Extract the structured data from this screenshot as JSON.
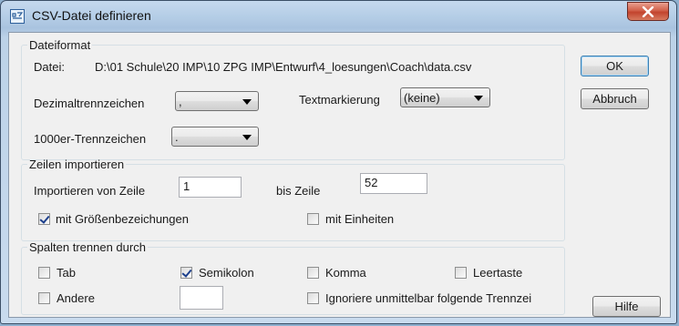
{
  "window": {
    "title": "CSV-Datei definieren"
  },
  "dateiformat": {
    "legend": "Dateiformat",
    "datei_label": "Datei:",
    "datei_path": "D:\\01 Schule\\20 IMP\\10 ZPG IMP\\Entwurf\\4_loesungen\\Coach\\data.csv",
    "dezimal_label": "Dezimaltrennzeichen",
    "dezimal_value": ",",
    "textmark_label": "Textmarkierung",
    "textmark_value": "(keine)",
    "tausend_label": "1000er-Trennzeichen",
    "tausend_value": "."
  },
  "zeilen": {
    "legend": "Zeilen importieren",
    "von_label": "Importieren von Zeile",
    "von_value": "1",
    "bis_label": "bis Zeile",
    "bis_value": "52",
    "groessen_label": "mit Größenbezeichungen",
    "groessen_checked": true,
    "einheiten_label": "mit Einheiten",
    "einheiten_checked": false
  },
  "spalten": {
    "legend": "Spalten trennen durch",
    "tab_label": "Tab",
    "tab_checked": false,
    "semikolon_label": "Semikolon",
    "semikolon_checked": true,
    "komma_label": "Komma",
    "komma_checked": false,
    "leertaste_label": "Leertaste",
    "leertaste_checked": false,
    "andere_label": "Andere",
    "andere_checked": false,
    "andere_value": "",
    "ignoriere_label": "Ignoriere unmittelbar folgende Trennzei",
    "ignoriere_checked": false
  },
  "buttons": {
    "ok": "OK",
    "abbruch": "Abbruch",
    "hilfe": "Hilfe"
  }
}
